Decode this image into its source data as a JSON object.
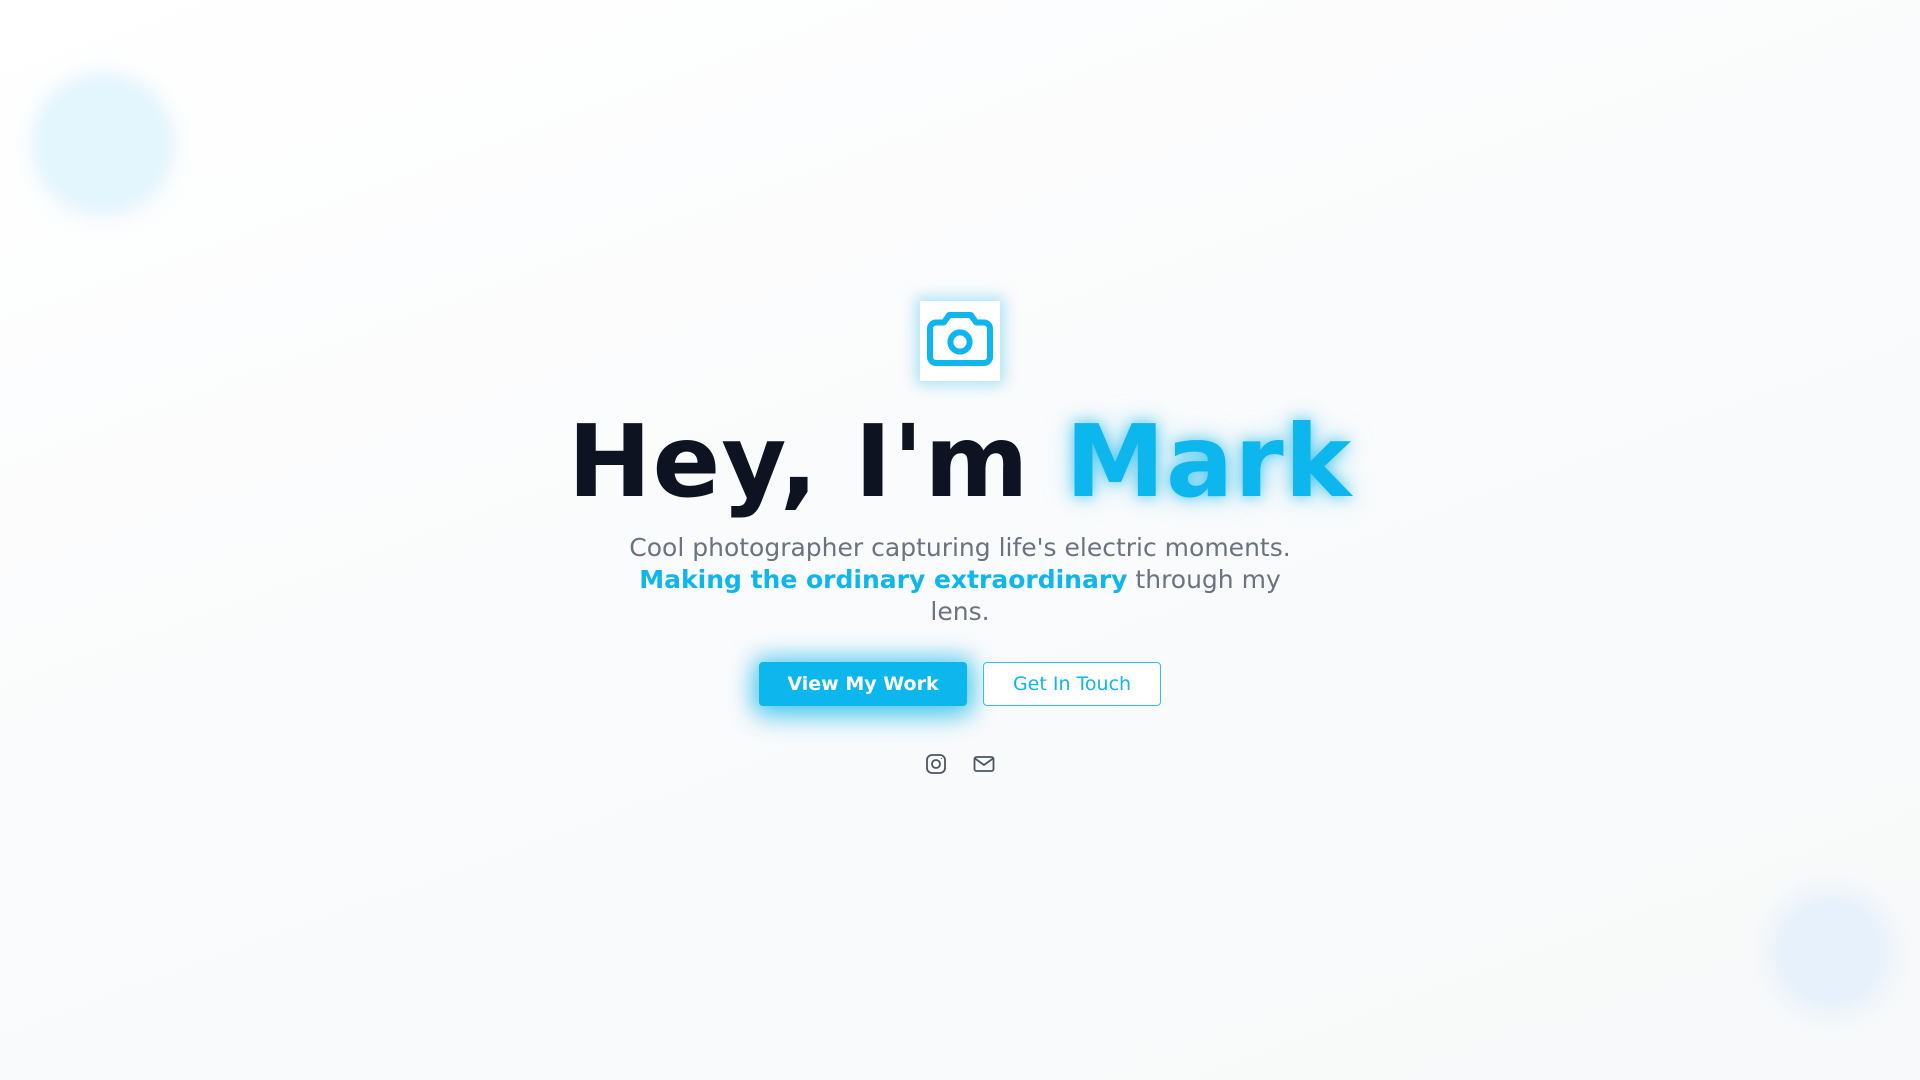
{
  "hero": {
    "logo_icon": "camera-icon",
    "headline_prefix": "Hey, I'm ",
    "headline_name": "Mark",
    "tagline_line1": "Cool photographer capturing life's electric moments.",
    "tagline_highlight": "Making the ordinary extraordinary",
    "tagline_rest": " through my lens."
  },
  "actions": {
    "primary_label": "View My Work",
    "secondary_label": "Get In Touch"
  },
  "social": {
    "icons": [
      "instagram-icon",
      "mail-icon"
    ]
  },
  "colors": {
    "accent": "#0db6ec",
    "heading": "#0d1321",
    "body_text": "#6b7280",
    "background": "#fafbfc"
  }
}
